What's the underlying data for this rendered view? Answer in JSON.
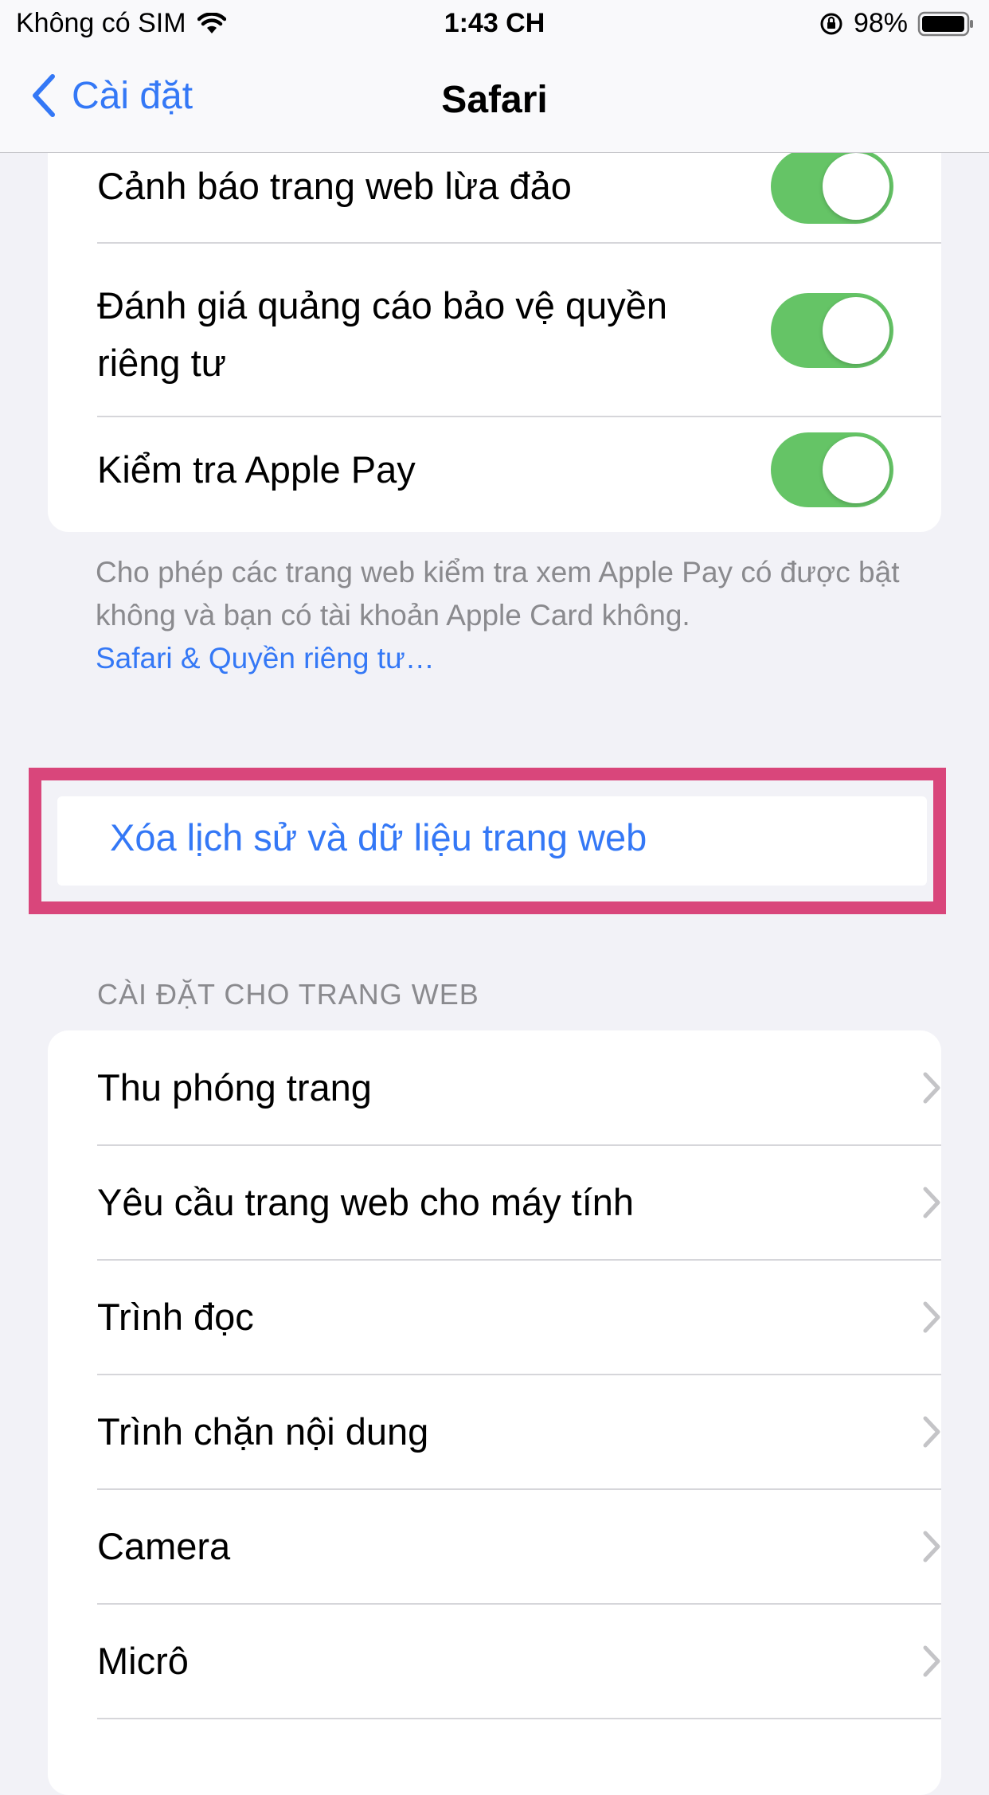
{
  "status_bar": {
    "carrier": "Không có SIM",
    "time": "1:43 CH",
    "battery": "98%",
    "battery_level": 0.98
  },
  "nav": {
    "back_label": "Cài đặt",
    "title": "Safari"
  },
  "privacy_group": {
    "items": [
      {
        "label": "Cảnh báo trang web lừa đảo",
        "on": true
      },
      {
        "label": "Đánh giá quảng cáo bảo vệ quyền",
        "label_line2": "riêng tư",
        "on": true
      },
      {
        "label": "Kiểm tra Apple Pay",
        "on": true
      }
    ],
    "footer": "Cho phép các trang web kiểm tra xem Apple Pay có được bật không và bạn có tài khoản Apple Card không.",
    "footer_link": "Safari & Quyền riêng tư…"
  },
  "clear_history": {
    "label": "Xóa lịch sử và dữ liệu trang web"
  },
  "website_settings": {
    "header": "CÀI ĐẶT CHO TRANG WEB",
    "items": [
      {
        "label": "Thu phóng trang"
      },
      {
        "label": "Yêu cầu trang web cho máy tính"
      },
      {
        "label": "Trình đọc"
      },
      {
        "label": "Trình chặn nội dung"
      },
      {
        "label": "Camera"
      },
      {
        "label": "Micrô"
      }
    ]
  },
  "colors": {
    "accent": "#3478f6",
    "toggle_on": "#65c466",
    "highlight": "#d9467b"
  }
}
